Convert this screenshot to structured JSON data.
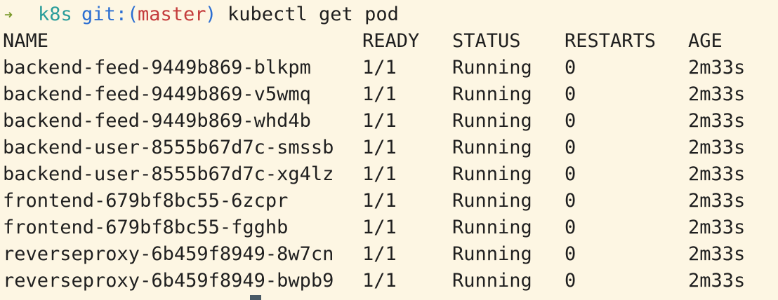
{
  "prompt": {
    "arrow": "➜",
    "dir": "k8s",
    "git": "git:(",
    "branch": "master",
    "close": ")",
    "command": "kubectl get pod"
  },
  "table": {
    "headers": [
      "NAME",
      "READY",
      "STATUS",
      "RESTARTS",
      "AGE"
    ],
    "rows": [
      [
        "backend-feed-9449b869-blkpm",
        "1/1",
        "Running",
        "0",
        "2m33s"
      ],
      [
        "backend-feed-9449b869-v5wmq",
        "1/1",
        "Running",
        "0",
        "2m33s"
      ],
      [
        "backend-feed-9449b869-whd4b",
        "1/1",
        "Running",
        "0",
        "2m33s"
      ],
      [
        "backend-user-8555b67d7c-smssb",
        "1/1",
        "Running",
        "0",
        "2m33s"
      ],
      [
        "backend-user-8555b67d7c-xg4lz",
        "1/1",
        "Running",
        "0",
        "2m33s"
      ],
      [
        "frontend-679bf8bc55-6zcpr",
        "1/1",
        "Running",
        "0",
        "2m33s"
      ],
      [
        "frontend-679bf8bc55-fgghb",
        "1/1",
        "Running",
        "0",
        "2m33s"
      ],
      [
        "reverseproxy-6b459f8949-8w7cn",
        "1/1",
        "Running",
        "0",
        "2m33s"
      ],
      [
        "reverseproxy-6b459f8949-bwpb9",
        "1/1",
        "Running",
        "0",
        "2m33s"
      ]
    ]
  },
  "colors": {
    "background": "#fdf6e3",
    "arrow": "#7a9a2a",
    "dir": "#2a9d9a",
    "git": "#2b6ed2",
    "branch": "#c43c3c",
    "text": "#1f1f1f"
  }
}
